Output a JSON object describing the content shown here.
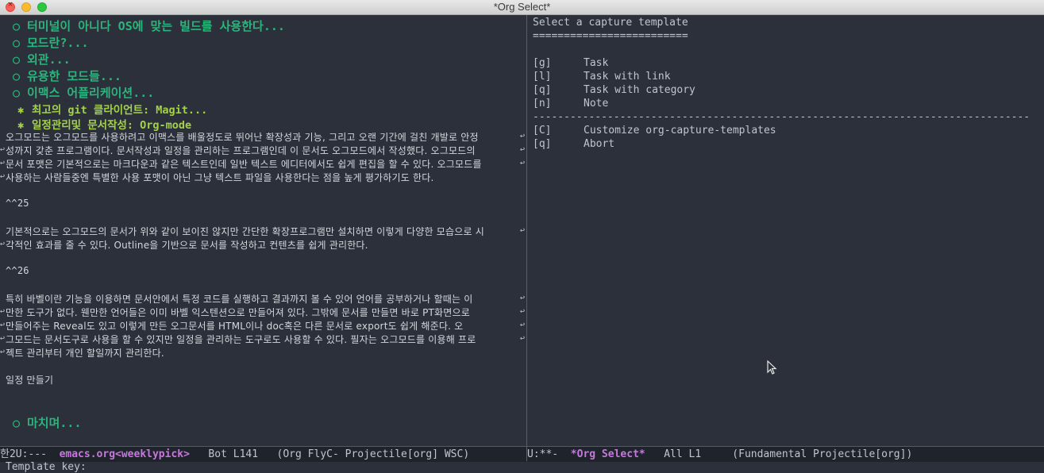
{
  "window": {
    "title": "*Org Select*"
  },
  "left_pane": {
    "headings": [
      {
        "bullet": "○",
        "text": "터미널이 아니다 OS에 맞는 빌드를 사용한다..."
      },
      {
        "bullet": "○",
        "text": "모드란?..."
      },
      {
        "bullet": "○",
        "text": "외관..."
      },
      {
        "bullet": "○",
        "text": "유용한 모드들..."
      },
      {
        "bullet": "○",
        "text": "이맥스 어플리케이션..."
      }
    ],
    "subheadings": [
      {
        "bullet": "✱",
        "text": "최고의 git 클라이언트: Magit..."
      },
      {
        "bullet": "✱",
        "text": "일정관리및 문서작성: Org-mode"
      }
    ],
    "paragraph1": [
      "오그모드는 오그모드를 사용하려고 이맥스를 배울정도로 뛰어난 확장성과 기능, 그리고 오랜 기간에 걸친 개발로 안정",
      "성까지 갖춘 프로그램이다. 문서작성과 일정을 관리하는 프로그램인데 이 문서도 오그모드에서 작성했다. 오그모드의",
      "문서 포맷은 기본적으로는 마크다운과 같은 텍스트인데 일반 텍스트 에디터에서도 쉽게 편집을 할 수 있다. 오그모드를",
      " 사용하는 사람들중엔 특별한 사용 포맷이 아닌 그냥 텍스트 파일을 사용한다는 점을 높게 평가하기도 한다."
    ],
    "footnote1": "^^25",
    "paragraph2": [
      "기본적으로는 오그모드의 문서가 위와 같이 보이진 않지만 간단한 확장프로그램만 설치하면 이렇게 다양한 모습으로 시",
      "각적인 효과를 줄 수 있다. Outline을 기반으로 문서를 작성하고 컨텐츠를 쉽게 관리한다."
    ],
    "footnote2": "^^26",
    "paragraph3": [
      "특히 바벨이란 기능을 이용하면 문서안에서 특정 코드를 실행하고 결과까지 볼 수 있어 언어를 공부하거나 할때는 이",
      "만한 도구가 없다. 웬만한 언어들은 이미 바벨 익스텐션으로 만들어져 있다. 그밖에 문서를 만들면 바로 PT화면으로",
      "만들어주는 Reveal도 있고 이렇게 만든 오그문서를 HTML이나 doc혹은 다른 문서로 export도 쉽게 해준다. 오",
      "그모드는 문서도구로 사용을 할 수 있지만 일정을 관리하는 도구로도 사용할 수 있다. 필자는 오그모드를 이용해 프로",
      "젝트 관리부터 개인 할일까지 관리한다."
    ],
    "plain_line": "일정 만들기",
    "last_heading": {
      "bullet": "○",
      "text": "마치며..."
    },
    "wrap_glyph": "↩"
  },
  "right_pane": {
    "title": "Select a capture template",
    "underline": "=========================",
    "options": [
      {
        "key": "[g]",
        "label": "Task"
      },
      {
        "key": "[l]",
        "label": "Task with link"
      },
      {
        "key": "[q]",
        "label": "Task with category"
      },
      {
        "key": "[n]",
        "label": "Note"
      }
    ],
    "separator": "--------------------------------------------------------------------------------",
    "options2": [
      {
        "key": "[C]",
        "label": "Customize org-capture-templates"
      },
      {
        "key": "[q]",
        "label": "Abort"
      }
    ]
  },
  "modeline_left": {
    "prefix": "한2U:---  ",
    "buffer": "emacs.org<weeklypick>",
    "rest": "   Bot L141   (Org FlyC- Projectile[org] WSC)"
  },
  "modeline_right": {
    "prefix": "U:**-  ",
    "buffer": "*Org Select*",
    "rest": "   All L1     (Fundamental Projectile[org])"
  },
  "echo_area": "Template key:",
  "icons": {
    "close": "close-icon",
    "minimize": "minimize-icon",
    "zoom": "zoom-icon",
    "pointer": "mouse-pointer-icon"
  }
}
